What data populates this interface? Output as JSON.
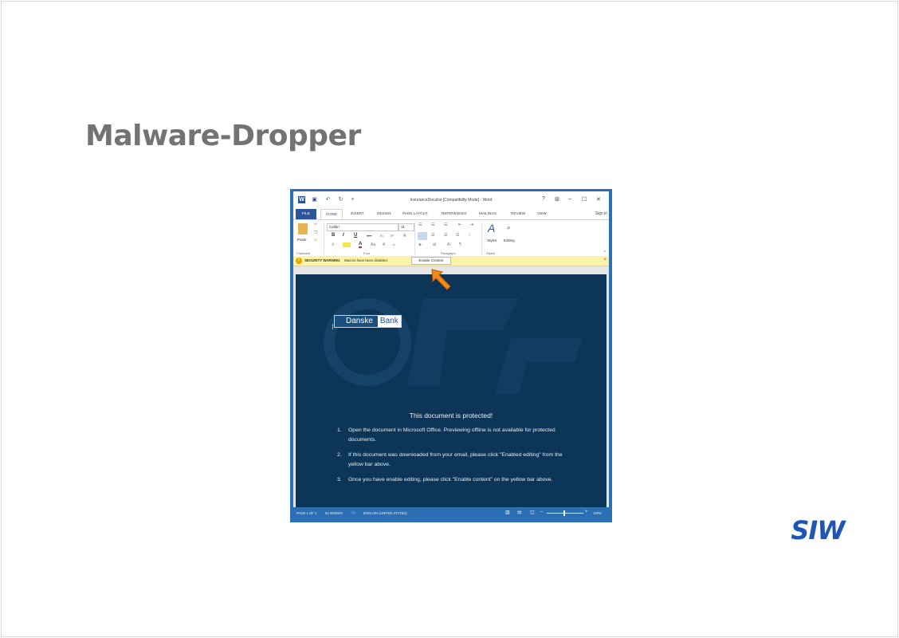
{
  "slide": {
    "title": "Malware-Dropper"
  },
  "word": {
    "window_title": "InsuranceDoculist [Compatibility Mode] - Word",
    "controls": {
      "help": "?",
      "restore_ribbon": "⊞",
      "minimize": "–",
      "maximize": "☐",
      "close": "✕"
    },
    "sign_in": "Sign in",
    "tabs": [
      "FILE",
      "HOME",
      "INSERT",
      "DESIGN",
      "PAGE LAYOUT",
      "REFERENCES",
      "MAILINGS",
      "REVIEW",
      "VIEW"
    ],
    "ribbon": {
      "paste_label": "Paste",
      "font_name": "Calibri",
      "font_size": "11",
      "styles_label": "Styles",
      "editing_label": "Editing",
      "groups": [
        "Clipboard",
        "Font",
        "Paragraph",
        "Styles"
      ],
      "format_buttons": {
        "bold": "B",
        "italic": "I",
        "underline": "U",
        "strike": "abc",
        "subscript": "x₂",
        "superscript": "x²",
        "clear": "A",
        "grow": "A",
        "shrink": "A",
        "case": "Aa",
        "pilcrow": "¶",
        "sort": "A↓"
      }
    },
    "security_bar": {
      "label": "SECURITY WARNING",
      "message": "Macros have been disabled.",
      "button": "Enable Content",
      "close": "×"
    },
    "document": {
      "logo": {
        "part1": "Danske",
        "part2": "Bank"
      },
      "heading": "This document is protected!",
      "steps": [
        {
          "num": "1.",
          "text": "Open the document in Microsoft Office. Previewing offline is not available for protected documents."
        },
        {
          "num": "2.",
          "text": "If this document was downloaded from your email, please click \"Enabled editing\" from the yellow bar above."
        },
        {
          "num": "3.",
          "text": "Once you have enable editing, please click \"Enable content\" on the yellow bar above."
        }
      ]
    },
    "status_bar": {
      "page": "PAGE 1 OF 1",
      "words": "52 WORDS",
      "language": "ENGLISH (UNITED STATES)",
      "zoom": "100%"
    }
  },
  "brand": {
    "logo_text": "SIW"
  }
}
